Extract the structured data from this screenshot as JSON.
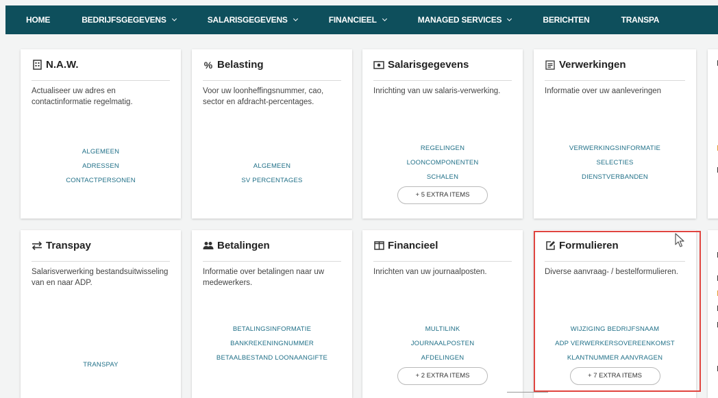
{
  "nav": {
    "items": [
      {
        "label": "HOME",
        "dropdown": false
      },
      {
        "label": "BEDRIJFSGEGEVENS",
        "dropdown": true
      },
      {
        "label": "SALARISGEGEVENS",
        "dropdown": true
      },
      {
        "label": "FINANCIEEL",
        "dropdown": true
      },
      {
        "label": "MANAGED SERVICES",
        "dropdown": true
      },
      {
        "label": "BERICHTEN",
        "dropdown": false
      },
      {
        "label": "TRANSPA",
        "dropdown": false
      }
    ]
  },
  "cards": [
    {
      "title": "N.A.W.",
      "icon": "building-icon",
      "description": "Actualiseer uw adres en contactinformatie regelmatig.",
      "links": [
        "ALGEMEEN",
        "ADRESSEN",
        "CONTACTPERSONEN"
      ]
    },
    {
      "title": "Belasting",
      "icon": "percent-icon",
      "description": "Voor uw loonheffingsnummer, cao, sector en afdracht-percentages.",
      "links": [
        "ALGEMEEN",
        "SV PERCENTAGES"
      ]
    },
    {
      "title": "Salarisgegevens",
      "icon": "money-icon",
      "description": "Inrichting van uw salaris-verwerking.",
      "links": [
        "REGELINGEN",
        "LOONCOMPONENTEN",
        "SCHALEN"
      ],
      "extra": "+ 5 EXTRA ITEMS"
    },
    {
      "title": "Verwerkingen",
      "icon": "processing-icon",
      "description": "Informatie over uw aanleveringen",
      "links": [
        "VERWERKINGSINFORMATIE",
        "SELECTIES",
        "DIENSTVERBANDEN"
      ]
    },
    {
      "title": "Transpay",
      "icon": "exchange-icon",
      "description": "Salarisverwerking bestandsuitwisseling van en naar ADP.",
      "links": [
        "TRANSPAY"
      ]
    },
    {
      "title": "Betalingen",
      "icon": "users-icon",
      "description": "Informatie over betalingen naar uw medewerkers.",
      "links": [
        "BETALINGSINFORMATIE",
        "BANKREKENINGNUMMER",
        "BETAALBESTAND LOONAANGIFTE"
      ]
    },
    {
      "title": "Financieel",
      "icon": "columns-icon",
      "description": "Inrichten van uw journaalposten.",
      "links": [
        "MULTILINK",
        "JOURNAALPOSTEN",
        "AFDELINGEN"
      ],
      "extra": "+ 2 EXTRA ITEMS"
    },
    {
      "title": "Formulieren",
      "icon": "edit-icon",
      "description": "Diverse aanvraag- / bestelformulieren.",
      "links": [
        "WIJZIGING BEDRIJFSNAAM",
        "ADP VERWERKERSOVEREENKOMST",
        "KLANTNUMMER AANVRAGEN"
      ],
      "extra": "+ 7 EXTRA ITEMS"
    }
  ],
  "colors": {
    "nav_bg": "#0e4f5c",
    "link": "#1f6f87",
    "highlight": "#e0443f",
    "partial_accent": "#e39b2b"
  }
}
